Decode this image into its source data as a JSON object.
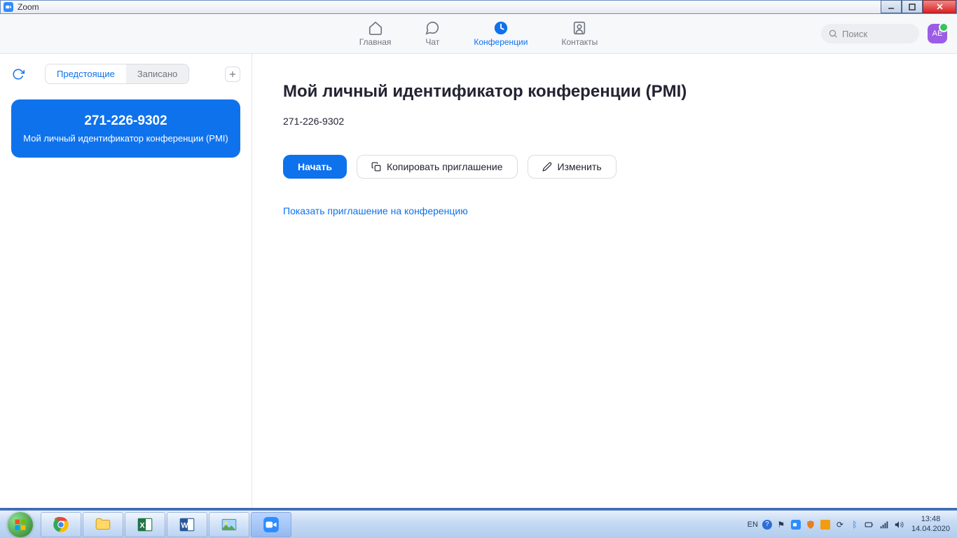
{
  "window": {
    "title": "Zoom"
  },
  "nav": {
    "home": "Главная",
    "chat": "Чат",
    "meetings": "Конференции",
    "contacts": "Контакты"
  },
  "search": {
    "placeholder": "Поиск"
  },
  "avatar": {
    "initials": "AE"
  },
  "sidebar": {
    "tab_upcoming": "Предстоящие",
    "tab_recorded": "Записано",
    "card_id": "271-226-9302",
    "card_sub": "Мой личный идентификатор конференции (PMI)"
  },
  "content": {
    "title": "Мой личный идентификатор конференции (PMI)",
    "pmi": "271-226-9302",
    "btn_start": "Начать",
    "btn_copy": "Копировать приглашение",
    "btn_edit": "Изменить",
    "link_show": "Показать приглашение на конференцию"
  },
  "taskbar": {
    "lang": "EN",
    "time": "13:48",
    "date": "14.04.2020"
  }
}
